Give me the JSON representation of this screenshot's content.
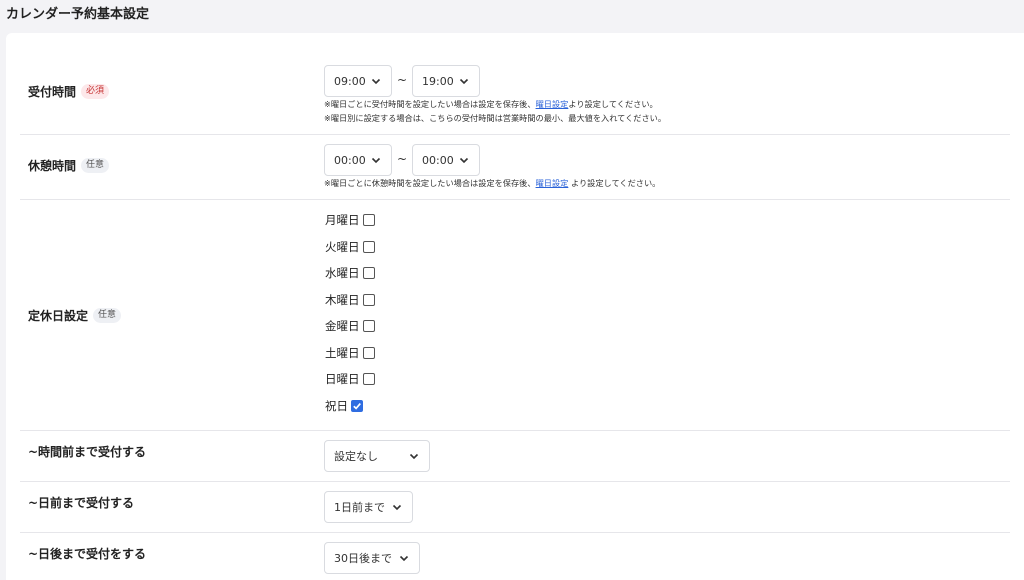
{
  "page_title": "カレンダー予約基本設定",
  "badges": {
    "required": "必須",
    "optional": "任意"
  },
  "tilde": "~",
  "reception_time": {
    "label": "受付時間",
    "start": "09:00",
    "end": "19:00",
    "note1_pre": "※曜日ごとに受付時間を設定したい場合は設定を保存後、",
    "note1_link": "曜日設定",
    "note1_post": "より設定してください。",
    "note2": "※曜日別に設定する場合は、こちらの受付時間は営業時間の最小、最大値を入れてください。"
  },
  "break_time": {
    "label": "休憩時間",
    "start": "00:00",
    "end": "00:00",
    "note_pre": "※曜日ごとに休憩時間を設定したい場合は設定を保存後、",
    "note_link": "曜日設定",
    "note_post": "より設定してください。"
  },
  "holidays": {
    "label": "定休日設定",
    "days": [
      {
        "label": "月曜日",
        "checked": false
      },
      {
        "label": "火曜日",
        "checked": false
      },
      {
        "label": "水曜日",
        "checked": false
      },
      {
        "label": "木曜日",
        "checked": false
      },
      {
        "label": "金曜日",
        "checked": false
      },
      {
        "label": "土曜日",
        "checked": false
      },
      {
        "label": "日曜日",
        "checked": false
      },
      {
        "label": "祝日",
        "checked": true
      }
    ]
  },
  "hours_before": {
    "label": "~時間前まで受付する",
    "value": "設定なし"
  },
  "days_before": {
    "label": "~日前まで受付する",
    "value": "1日前まで"
  },
  "days_after": {
    "label": "~日後まで受付をする",
    "value": "30日後まで"
  },
  "icons": {
    "dropdown": "chevron-down-icon",
    "check": "check-icon"
  },
  "colors": {
    "accent": "#2f6de1",
    "link": "#2a62d8",
    "required_badge": "#c53030"
  }
}
